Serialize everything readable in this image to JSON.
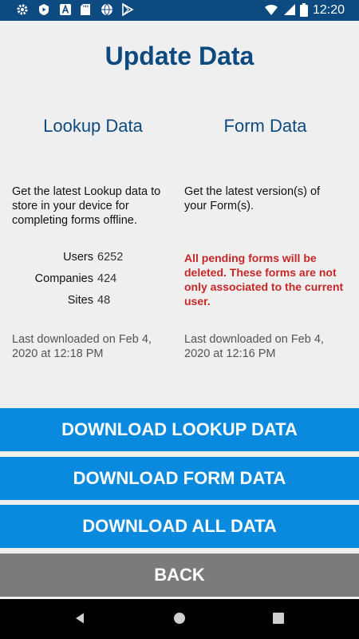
{
  "status_bar": {
    "time": "12:20",
    "left_icons": [
      "gear-icon",
      "shield-play-icon",
      "font-a-icon",
      "sd-card-icon",
      "globe-icon",
      "play-store-icon"
    ],
    "right_icons": [
      "wifi-icon",
      "signal-icon",
      "battery-icon"
    ]
  },
  "page": {
    "title": "Update Data"
  },
  "lookup": {
    "heading": "Lookup Data",
    "description": "Get the latest Lookup data to store in your device for completing forms offline.",
    "stats": [
      {
        "label": "Users",
        "value": "6252"
      },
      {
        "label": "Companies",
        "value": "424"
      },
      {
        "label": "Sites",
        "value": "48"
      }
    ],
    "last_downloaded": "Last downloaded on Feb 4, 2020 at 12:18 PM"
  },
  "form": {
    "heading": "Form Data",
    "description": "Get the latest version(s) of your Form(s).",
    "warning": "All pending forms will be deleted. These forms are not only associated to the current user.",
    "last_downloaded": "Last downloaded on Feb 4, 2020 at 12:16 PM"
  },
  "buttons": {
    "download_lookup": "DOWNLOAD LOOKUP DATA",
    "download_form": "DOWNLOAD FORM DATA",
    "download_all": "DOWNLOAD ALL DATA",
    "back": "BACK"
  },
  "colors": {
    "accent": "#0a8adf",
    "title": "#0d4a80",
    "warning": "#c62828",
    "back_button": "#7b7b7b"
  }
}
